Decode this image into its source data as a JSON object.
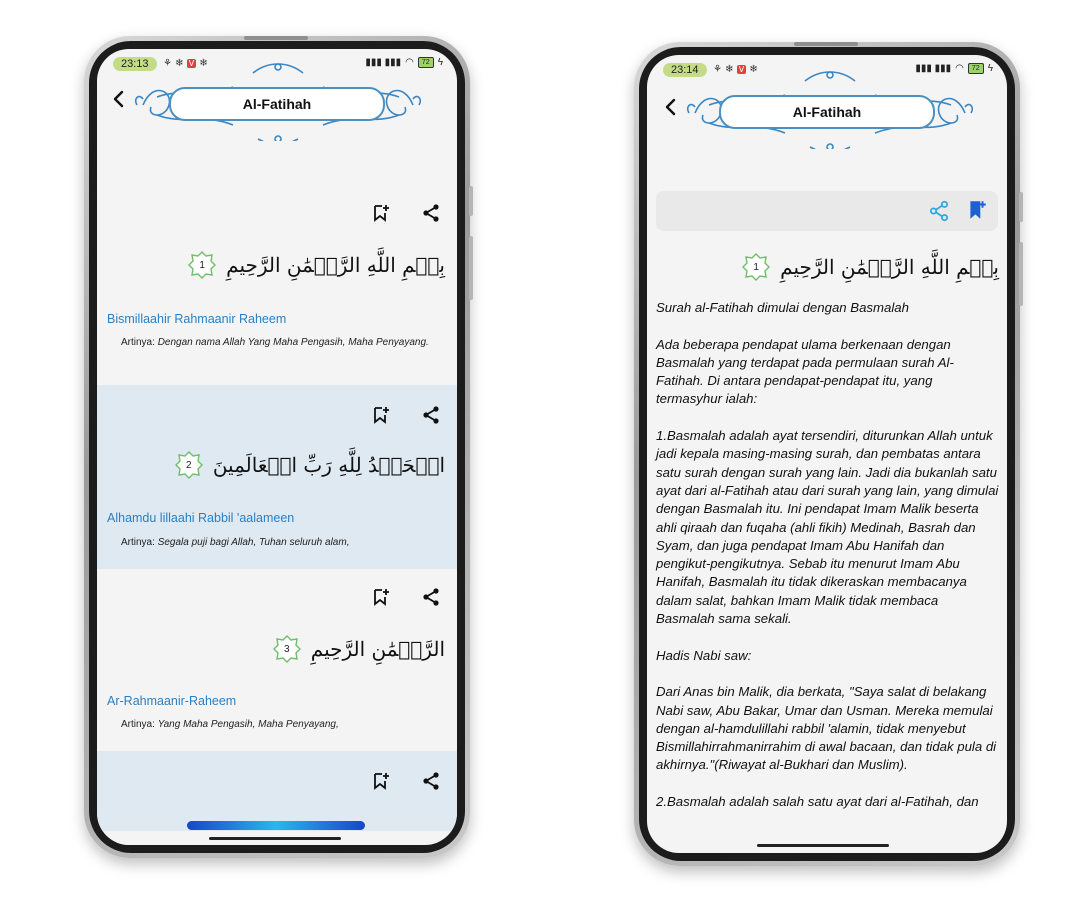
{
  "left_phone": {
    "status": {
      "time": "23:13",
      "battery": "72"
    },
    "header": {
      "title": "Al-Fatihah"
    },
    "verses": [
      {
        "number": "1",
        "arabic": "بِسۡمِ اللَّهِ الرَّحۡمَٰنِ الرَّحِيمِ",
        "latin": "Bismillaahir Rahmaanir Raheem",
        "meaning_label": "Artinya:",
        "meaning": "Dengan nama Allah Yang Maha Pengasih, Maha Penyayang."
      },
      {
        "number": "2",
        "arabic": "الۡحَمۡدُ لِلَّهِ رَبِّ الۡعَالَمِينَ",
        "latin": "Alhamdu lillaahi Rabbil 'aalameen",
        "meaning_label": "Artinya:",
        "meaning": "Segala puji bagi Allah, Tuhan seluruh alam,"
      },
      {
        "number": "3",
        "arabic": "الرَّحۡمَٰنِ الرَّحِيمِ",
        "latin": "Ar-Rahmaanir-Raheem",
        "meaning_label": "Artinya:",
        "meaning": "Yang Maha Pengasih, Maha Penyayang,"
      }
    ]
  },
  "right_phone": {
    "status": {
      "time": "23:14",
      "battery": "72"
    },
    "header": {
      "title": "Al-Fatihah"
    },
    "verse": {
      "number": "1",
      "arabic": "بِسۡمِ اللَّهِ الرَّحۡمَٰنِ الرَّحِيمِ"
    },
    "tafsir": "Surah al-Fatihah dimulai dengan Basmalah\n\nAda beberapa pendapat ulama berkenaan dengan Basmalah yang terdapat pada permulaan surah Al-Fatihah. Di antara pendapat-pendapat itu, yang termasyhur ialah:\n\n1.Basmalah adalah ayat tersendiri, diturunkan Allah untuk jadi kepala masing-masing surah, dan pembatas antara satu surah dengan surah yang lain. Jadi dia bukanlah satu ayat dari al-Fatihah atau dari surah yang lain, yang dimulai dengan Basmalah itu. Ini pendapat Imam Malik beserta ahli qiraah dan fuqaha (ahli fikih) Medinah, Basrah dan Syam, dan juga pendapat Imam Abu Hanifah dan pengikut-pengikutnya. Sebab itu menurut Imam Abu Hanifah, Basmalah itu tidak dikeraskan membacanya dalam salat, bahkan Imam Malik tidak membaca Basmalah sama sekali.\n\nHadis Nabi saw:\n\nDari Anas bin Malik, dia berkata, \"Saya salat di belakang Nabi saw, Abu Bakar, Umar dan Usman. Mereka memulai dengan al-hamdulillahi rabbil 'alamin, tidak menyebut Bismillahirrahmanirrahim di awal bacaan, dan tidak pula di akhirnya.\"(Riwayat al-Bukhari dan Muslim).\n\n2.Basmalah adalah salah satu ayat dari al-Fatihah, dan"
  },
  "colors": {
    "accent": "#2a7fc4",
    "alt_row": "#dfe9f2",
    "bookmark_blue": "#1f5fd6"
  }
}
